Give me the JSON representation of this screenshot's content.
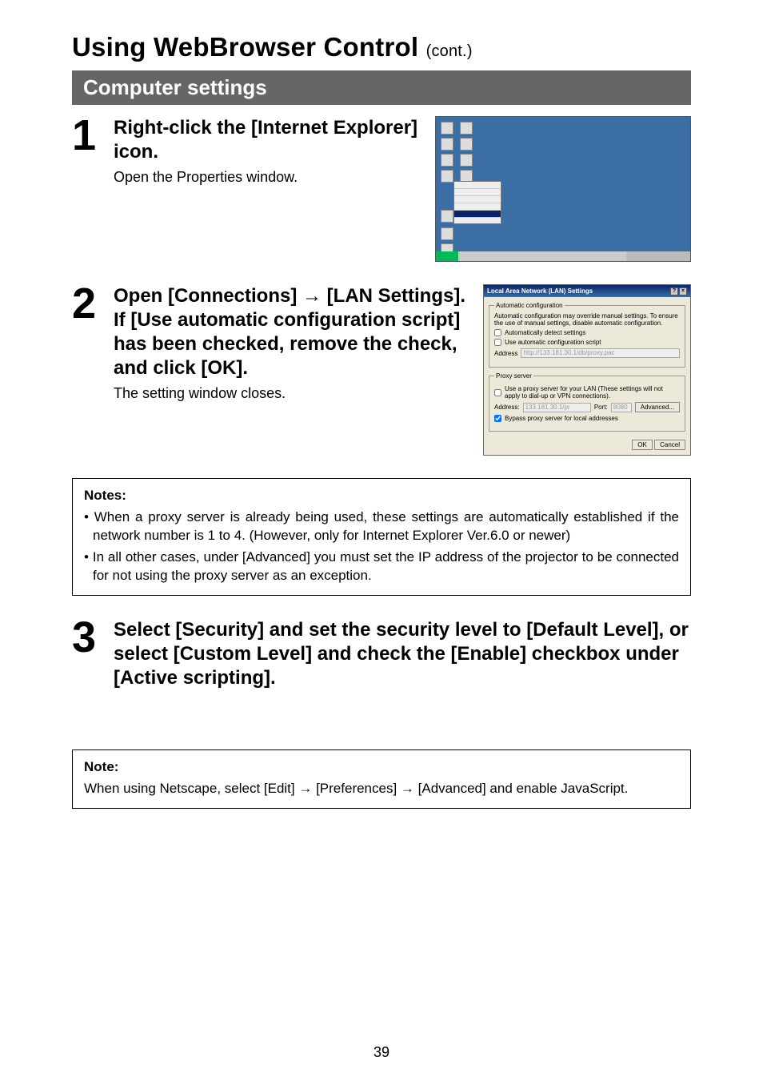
{
  "title": {
    "main": "Using WebBrowser Control ",
    "cont": "(cont.)"
  },
  "sectionBar": "Computer settings",
  "steps": {
    "s1": {
      "num": "1",
      "heading": "Right-click the [Internet Explorer] icon.",
      "desc": "Open the Properties window."
    },
    "s2": {
      "num": "2",
      "heading_part1": "Open [Connections] ",
      "heading_arrow": "→",
      "heading_part2": " [LAN Settings]. If [Use automatic configuration script] has been checked, remove the check, and click [OK].",
      "desc": "The setting window closes."
    },
    "s3": {
      "num": "3",
      "heading": "Select [Security] and set the security level to [Default Level], or select [Custom Level] and check the [Enable] checkbox under [Active scripting]."
    }
  },
  "lanDialog": {
    "title": "Local Area Network (LAN) Settings",
    "group1": {
      "legend": "Automatic configuration",
      "desc": "Automatic configuration may override manual settings. To ensure the use of manual settings, disable automatic configuration.",
      "chk1": "Automatically detect settings",
      "chk2": "Use automatic configuration script",
      "addrLabel": "Address",
      "addrValue": "http://133.181.30.1/db/proxy.pac"
    },
    "group2": {
      "legend": "Proxy server",
      "chk": "Use a proxy server for your LAN (These settings will not apply to dial-up or VPN connections).",
      "addrLabel": "Address:",
      "addrValue": "133.181.30.1/pr",
      "portLabel": "Port:",
      "portValue": "8080",
      "advanced": "Advanced...",
      "bypass": "Bypass proxy server for local addresses"
    },
    "ok": "OK",
    "cancel": "Cancel"
  },
  "notesBox1": {
    "title": "Notes:",
    "b1": "• When a proxy server is already being used, these settings are automatically established if the network number is 1 to 4. (However, only for Internet Explorer Ver.6.0 or newer)",
    "b2": "• In all other cases, under [Advanced] you must set the IP address of the projector to be connected for not using the proxy server as an exception."
  },
  "notesBox2": {
    "title": "Note:",
    "line_pre": "When using Netscape, select [Edit] ",
    "arrow": "→",
    "line_mid1": " [Preferences] ",
    "line_mid2": " [Advanced] and enable JavaScript."
  },
  "pageNumber": "39"
}
